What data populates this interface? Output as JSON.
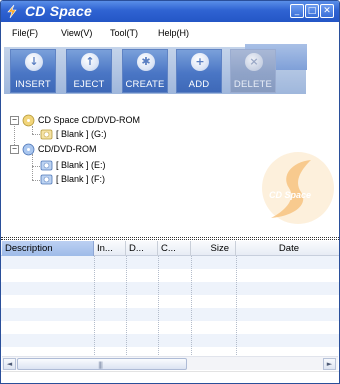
{
  "window": {
    "title": "CD Space"
  },
  "menu": [
    "File(F)",
    "View(V)",
    "Tool(T)",
    "Help(H)"
  ],
  "toolbar": [
    {
      "label": "INSERT",
      "icon": "insert-icon",
      "glyph": "↓",
      "enabled": true
    },
    {
      "label": "EJECT",
      "icon": "eject-icon",
      "glyph": "↑",
      "enabled": true
    },
    {
      "label": "CREATE",
      "icon": "create-icon",
      "glyph": "✱",
      "enabled": true
    },
    {
      "label": "ADD",
      "icon": "add-icon",
      "glyph": "+",
      "enabled": true
    },
    {
      "label": "DELETE",
      "icon": "delete-icon",
      "glyph": "×",
      "enabled": false
    }
  ],
  "tree": {
    "groups": [
      {
        "label": "CD Space CD/DVD-ROM",
        "expander": "−",
        "items": [
          {
            "label": "[ Blank ] (G:)"
          }
        ]
      },
      {
        "label": "CD/DVD-ROM",
        "expander": "−",
        "items": [
          {
            "label": "[ Blank ] (E:)"
          },
          {
            "label": "[ Blank ] (F:)"
          }
        ]
      }
    ],
    "watermark_text": "CD Space"
  },
  "list": {
    "columns": [
      {
        "label": "Description",
        "align": "left",
        "selected": true
      },
      {
        "label": "In...",
        "align": "left",
        "selected": false
      },
      {
        "label": "D...",
        "align": "left",
        "selected": false
      },
      {
        "label": "C...",
        "align": "left",
        "selected": false
      },
      {
        "label": "Size",
        "align": "right",
        "selected": false
      },
      {
        "label": "Date",
        "align": "right",
        "selected": false
      }
    ]
  },
  "scrollbar": {
    "grip": "|||",
    "left_arrow": "◄",
    "right_arrow": "►"
  },
  "colors": {
    "titlebar": "#2f63d2",
    "toolbar_button": "#4a76c5",
    "accent_orange": "#f0a030"
  }
}
